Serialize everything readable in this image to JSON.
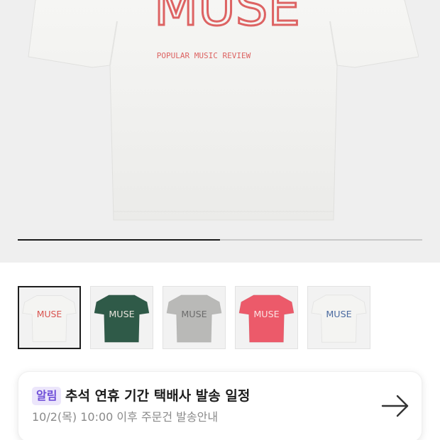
{
  "product": {
    "print_text": "MUSE",
    "print_subtext": "POPULAR MUSIC REVIEW",
    "image_progress": 0.5,
    "colors": {
      "background": "#efefef",
      "print_red": "#d94a4a",
      "track": "#c9c9c9",
      "fill": "#1a1a1a"
    }
  },
  "thumbnails": [
    {
      "color_name": "white-red",
      "tee_color": "#f4f4f2",
      "print_color": "#d9534f",
      "selected": true
    },
    {
      "color_name": "green",
      "tee_color": "#2f5a48",
      "print_color": "#e9e4dc",
      "selected": false
    },
    {
      "color_name": "gray",
      "tee_color": "#b9b9b7",
      "print_color": "#6c6c6c",
      "selected": false
    },
    {
      "color_name": "pink",
      "tee_color": "#ec5a6a",
      "print_color": "#fbe3e3",
      "selected": false
    },
    {
      "color_name": "white-blue",
      "tee_color": "#f4f4f2",
      "print_color": "#4a6aa0",
      "selected": false
    }
  ],
  "notice": {
    "badge": "알림",
    "title": "추석 연휴 기간 택배사 발송 일정",
    "subtitle": "10/2(목) 10:00 이후 주문건 발송안내",
    "arrow_icon": "arrow-right-icon",
    "badge_color": "#6e4dd8",
    "badge_bg": "#ece6fb"
  }
}
